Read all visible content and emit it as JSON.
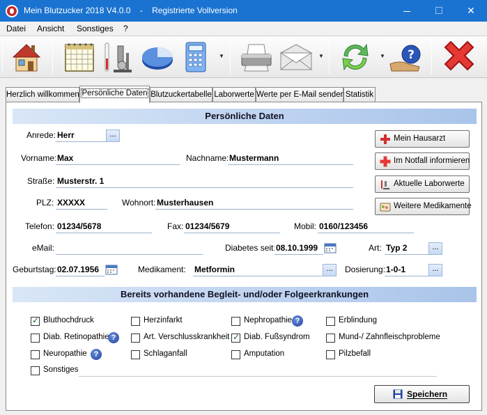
{
  "window": {
    "title": "Mein Blutzucker 2018 V4.0.0    -    Registrierte Vollversion"
  },
  "menu": [
    "Datei",
    "Ansicht",
    "Sonstiges",
    "?"
  ],
  "toolbar_icons": [
    "home-icon",
    "calendar-icon",
    "lab-icon",
    "pie-chart-icon",
    "calculator-icon",
    "printer-icon",
    "email-icon",
    "sync-icon",
    "help-icon",
    "close-icon"
  ],
  "tabs": [
    "Herzlich willkommen",
    "Persönliche Daten",
    "Blutzuckertabelle",
    "Laborwerte",
    "Werte per E-Mail senden",
    "Statistik"
  ],
  "active_tab": 1,
  "personal": {
    "header": "Persönliche Daten",
    "anrede_label": "Anrede:",
    "anrede": "Herr",
    "vorname_label": "Vorname:",
    "vorname": "Max",
    "nachname_label": "Nachname:",
    "nachname": "Mustermann",
    "strasse_label": "Straße:",
    "strasse": "Musterstr. 1",
    "plz_label": "PLZ:",
    "plz": "XXXXX",
    "wohnort_label": "Wohnort:",
    "wohnort": "Musterhausen",
    "telefon_label": "Telefon:",
    "telefon": "01234/5678",
    "fax_label": "Fax:",
    "fax": "01234/5679",
    "mobil_label": "Mobil:",
    "mobil": "0160/123456",
    "email_label": "eMail:",
    "email": "",
    "diabetes_label": "Diabetes seit:",
    "diabetes_seit": "08.10.1999",
    "art_label": "Art:",
    "art": "Typ 2",
    "geburtstag_label": "Geburtstag:",
    "geburtstag": "02.07.1956",
    "medikament_label": "Medikament:",
    "medikament": "Metformin",
    "dosierung_label": "Dosierung:",
    "dosierung": "1-0-1",
    "dots": "..."
  },
  "side_buttons": [
    "Mein Hausarzt",
    "Im Notfall informieren",
    "Aktuelle Laborwerte",
    "Weitere Medikamente"
  ],
  "conditions": {
    "header": "Bereits vorhandene Begleit- und/oder Folgeerkrankungen",
    "items": [
      {
        "label": "Bluthochdruck",
        "checked": true
      },
      {
        "label": "Herzinfarkt",
        "checked": false
      },
      {
        "label": "Nephropathie",
        "checked": false
      },
      {
        "label": "Erblindung",
        "checked": false
      },
      {
        "label": "Diab. Retinopathie",
        "checked": false
      },
      {
        "label": "Art. Verschlusskrankheit",
        "checked": false
      },
      {
        "label": "Diab. Fußsyndrom",
        "checked": true
      },
      {
        "label": "Mund-/ Zahnfleischprobleme",
        "checked": false
      },
      {
        "label": "Neuropathie",
        "checked": false
      },
      {
        "label": "Schlaganfall",
        "checked": false
      },
      {
        "label": "Amputation",
        "checked": false
      },
      {
        "label": "Pilzbefall",
        "checked": false
      }
    ],
    "sonstiges_label": "Sonstiges:",
    "sonstiges": "",
    "help_mark": "?"
  },
  "save_label": "Speichern",
  "colors": {
    "titlebar": "#1a73d0",
    "header_gradient": "#a9c4ea"
  }
}
